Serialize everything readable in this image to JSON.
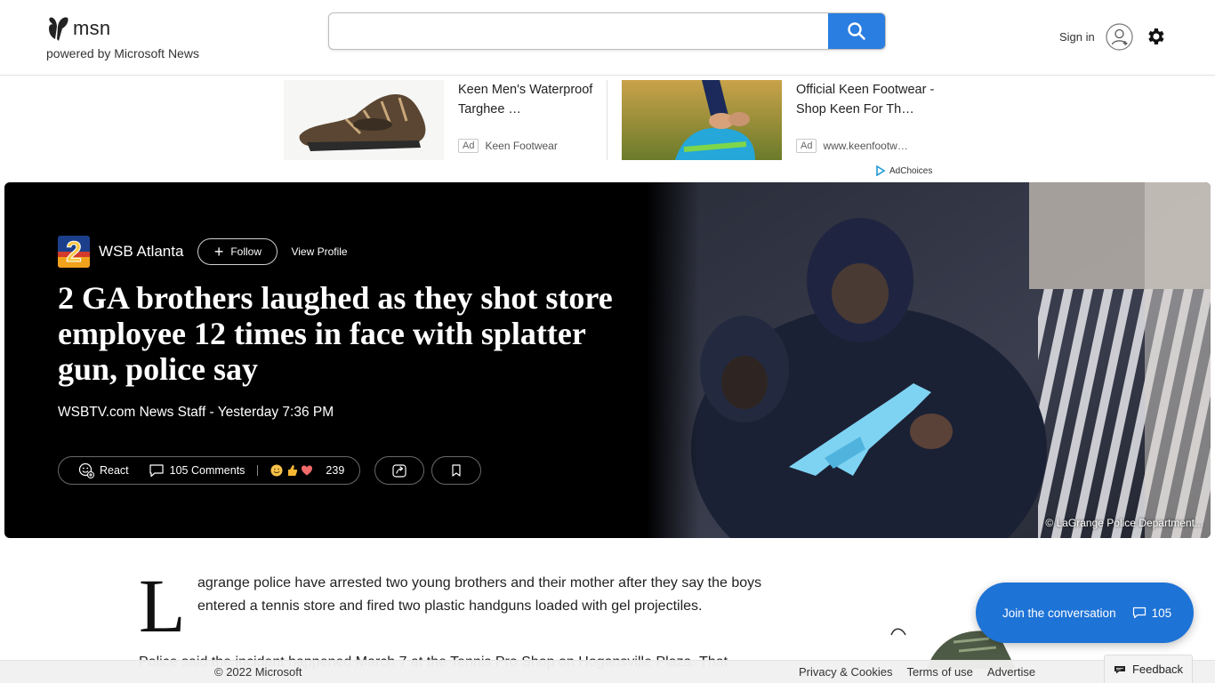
{
  "header": {
    "logo_text": "msn",
    "tagline": "powered by Microsoft News",
    "search_placeholder": "",
    "signin_label": "Sign in"
  },
  "ads": [
    {
      "title": "Keen Men's Waterproof Targhee …",
      "tag": "Ad",
      "source": "Keen Footwear"
    },
    {
      "title": "Official Keen Footwear - Shop Keen For Th…",
      "tag": "Ad",
      "source": "www.keenfootw…"
    }
  ],
  "adchoices_label": "AdChoices",
  "hero": {
    "publisher": "WSB Atlanta",
    "publisher_logo_text": "2",
    "follow_label": "Follow",
    "view_profile_label": "View Profile",
    "headline": "2 GA brothers laughed as they shot store employee 12 times in face with splatter gun, police say",
    "byline": "WSBTV.com News Staff - Yesterday 7:36 PM",
    "react_label": "React",
    "comments_label": "105 Comments",
    "reactions_count": "239",
    "image_credit": "© LaGrange Police Department..."
  },
  "article": {
    "dropcap": "L",
    "para1": "agrange police have arrested two young brothers and their mother after they say the boys entered a tennis store and fired two plastic handguns loaded with gel projectiles.",
    "para2": "Police said the incident happened March 7 at the Tennis Pro Shop on Hogansville Plaza. That"
  },
  "join": {
    "label": "Join the conversation",
    "count": "105"
  },
  "footer": {
    "copyright": "© 2022 Microsoft",
    "links": [
      "Privacy & Cookies",
      "Terms of use",
      "Advertise"
    ],
    "feedback": "Feedback"
  },
  "colors": {
    "search_button": "#2a7de1",
    "join_button": "#1e73d6",
    "hero_bg": "#000000"
  }
}
